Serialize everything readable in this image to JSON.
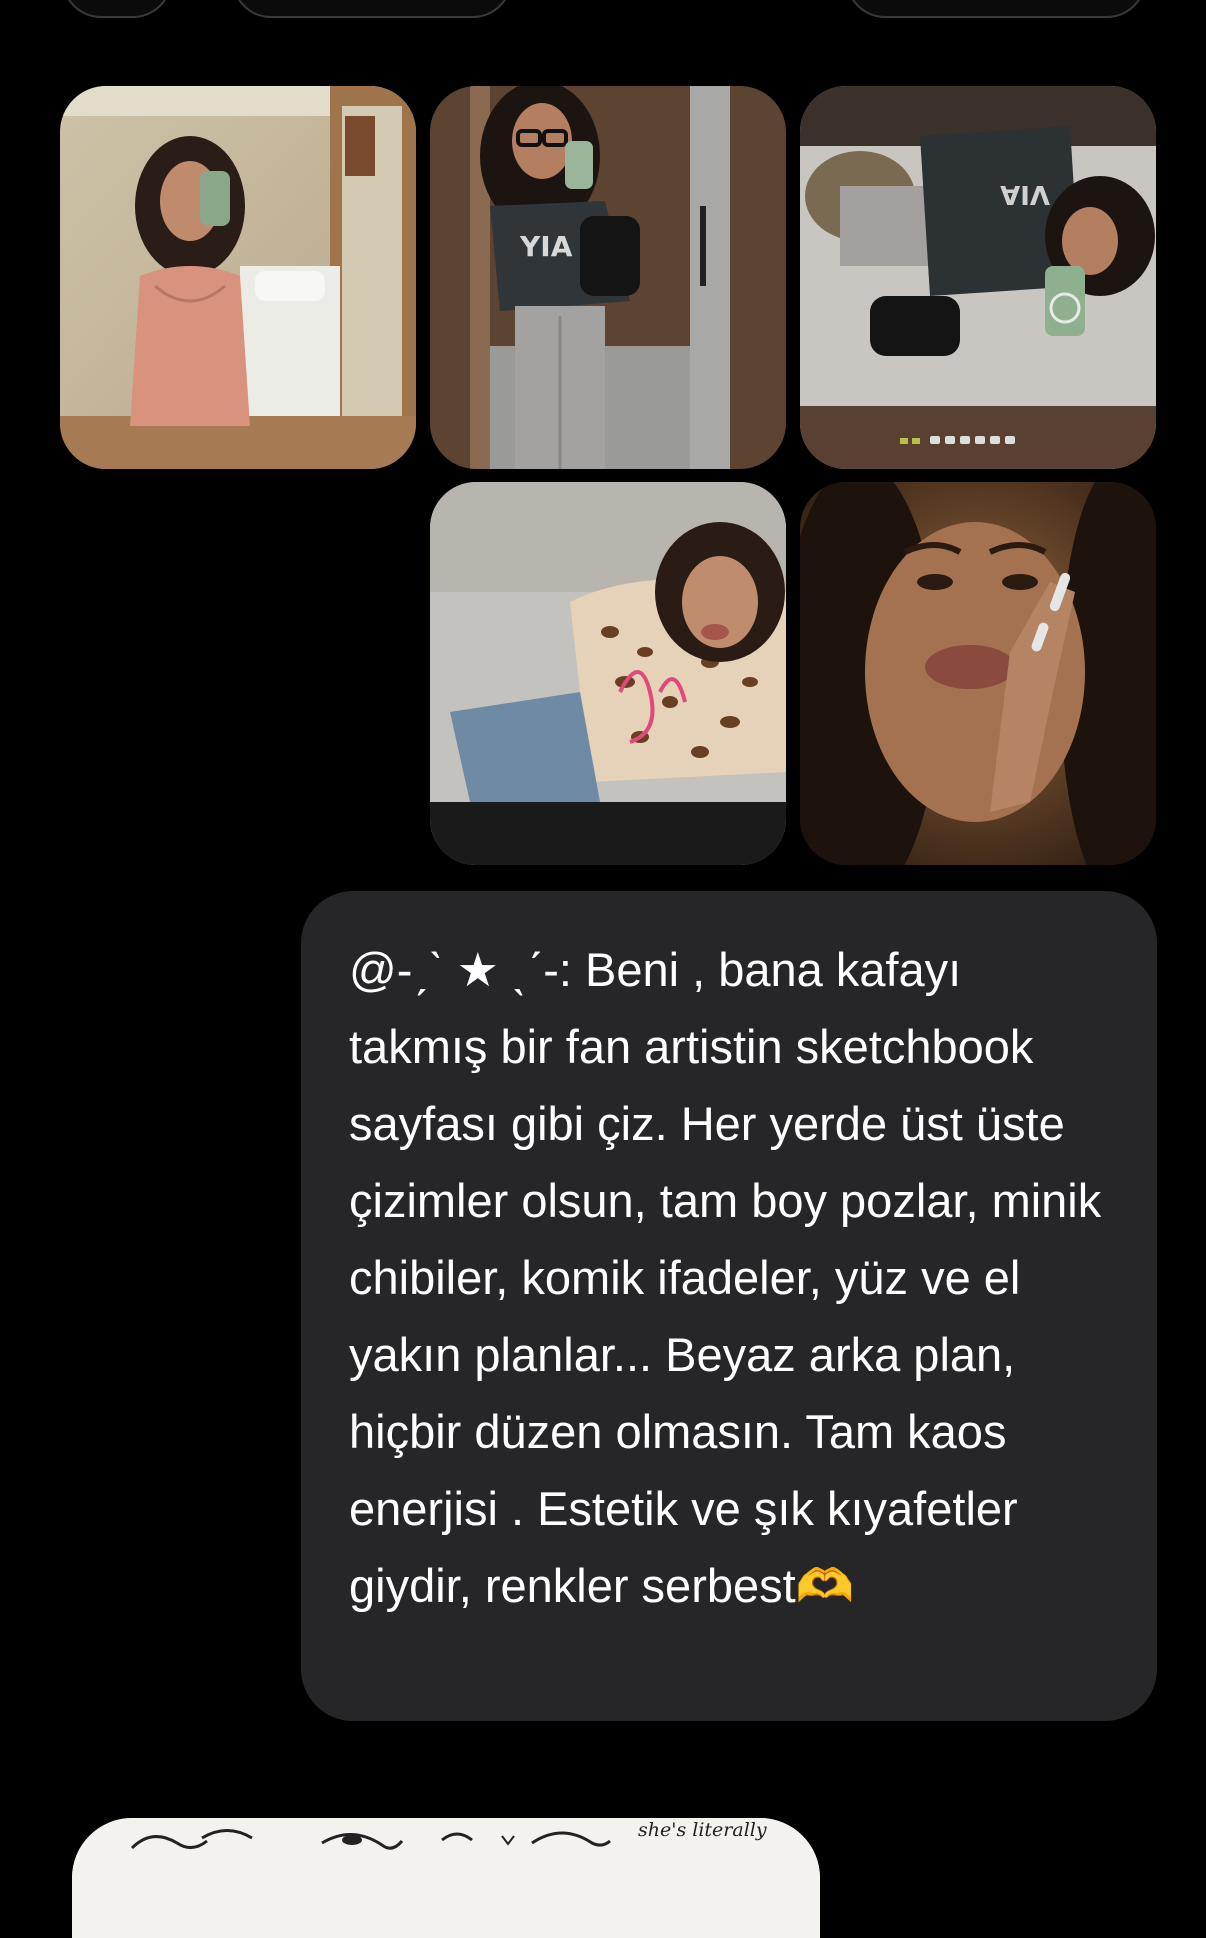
{
  "message": {
    "text": "@-ˏˋ ★ ˎˊ-: Beni , bana kafayı takmış bir fan artistin sketchbook sayfası gibi çiz. Her yerde üst üste çizimler olsun, tam boy pozlar, minik chibiler, komik ifadeler, yüz ve el yakın planlar... Beyaz arka plan, hiçbir düzen olmasın. Tam kaos enerjisi . Estetik ve şık kıyafetler giydir, renkler serbest🫶"
  },
  "photos": [
    {
      "icon": "mirror-selfie-pink-dress-photo"
    },
    {
      "icon": "elevator-mirror-selfie-glasses-photo"
    },
    {
      "icon": "rotated-elevator-mirror-selfie-photo"
    },
    {
      "icon": "leopard-top-selfie-photo"
    },
    {
      "icon": "hand-on-cheek-closeup-photo"
    }
  ],
  "preview": {
    "caption": "she's literally"
  },
  "colors": {
    "background": "#000000",
    "bubble": "#262628",
    "text": "#ffffff"
  }
}
